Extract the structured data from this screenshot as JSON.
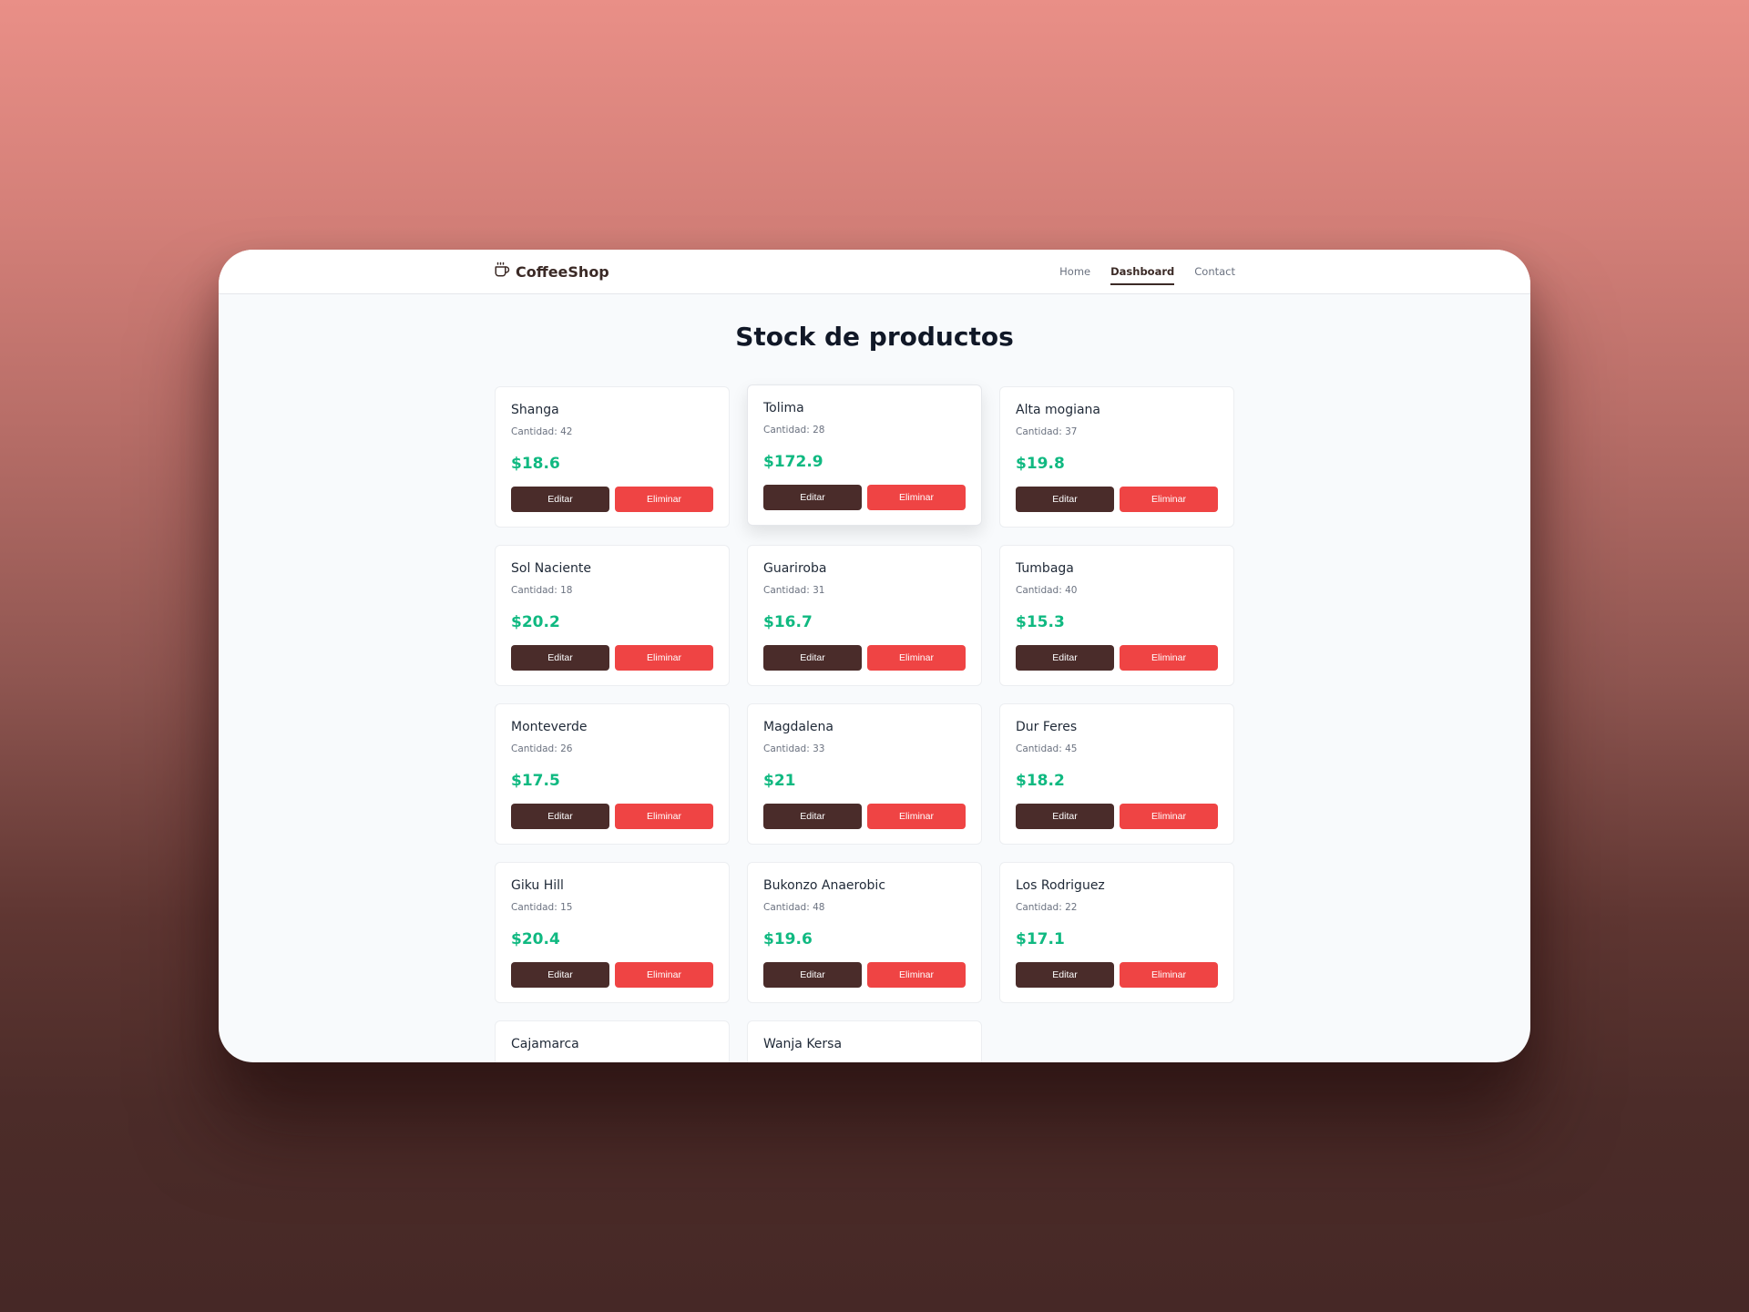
{
  "brand": {
    "name": "CoffeeShop",
    "icon": "coffee-cup-icon"
  },
  "nav": {
    "items": [
      {
        "label": "Home",
        "active": false
      },
      {
        "label": "Dashboard",
        "active": true
      },
      {
        "label": "Contact",
        "active": false
      }
    ]
  },
  "page": {
    "title": "Stock de productos"
  },
  "actions": {
    "edit_label": "Editar",
    "delete_label": "Eliminar"
  },
  "colors": {
    "brand_brown": "#4a2c2a",
    "danger_red": "#ef4444",
    "price_green": "#10b981"
  },
  "products": [
    {
      "name": "Shanga",
      "qty": "Cantidad: 42",
      "price": "$18.6"
    },
    {
      "name": "Tolima",
      "qty": "Cantidad: 28",
      "price": "$172.9"
    },
    {
      "name": "Alta mogiana",
      "qty": "Cantidad: 37",
      "price": "$19.8"
    },
    {
      "name": "Sol Naciente",
      "qty": "Cantidad: 18",
      "price": "$20.2"
    },
    {
      "name": "Guariroba",
      "qty": "Cantidad: 31",
      "price": "$16.7"
    },
    {
      "name": "Tumbaga",
      "qty": "Cantidad: 40",
      "price": "$15.3"
    },
    {
      "name": "Monteverde",
      "qty": "Cantidad: 26",
      "price": "$17.5"
    },
    {
      "name": "Magdalena",
      "qty": "Cantidad: 33",
      "price": "$21"
    },
    {
      "name": "Dur Feres",
      "qty": "Cantidad: 45",
      "price": "$18.2"
    },
    {
      "name": "Giku Hill",
      "qty": "Cantidad: 15",
      "price": "$20.4"
    },
    {
      "name": "Bukonzo Anaerobic",
      "qty": "Cantidad: 48",
      "price": "$19.6"
    },
    {
      "name": "Los Rodriguez",
      "qty": "Cantidad: 22",
      "price": "$17.1"
    },
    {
      "name": "Cajamarca"
    },
    {
      "name": "Wanja Kersa"
    }
  ]
}
